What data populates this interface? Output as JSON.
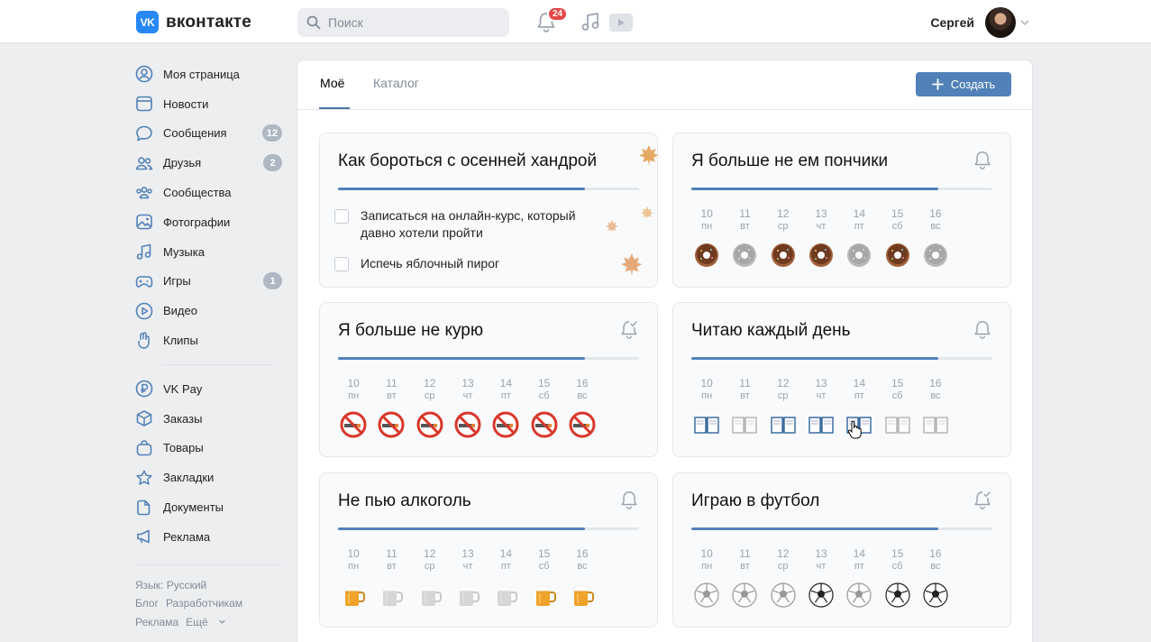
{
  "header": {
    "logo_badge": "VK",
    "logo_text": "вконтакте",
    "search_placeholder": "Поиск",
    "notifications_count": "24",
    "user_name": "Сергей"
  },
  "sidebar": {
    "items": [
      {
        "label": "Моя страница",
        "icon": "user-circle-icon"
      },
      {
        "label": "Новости",
        "icon": "newspaper-icon"
      },
      {
        "label": "Сообщения",
        "icon": "message-icon",
        "count": "12"
      },
      {
        "label": "Друзья",
        "icon": "friends-icon",
        "count": "2"
      },
      {
        "label": "Сообщества",
        "icon": "communities-icon"
      },
      {
        "label": "Фотографии",
        "icon": "photo-icon"
      },
      {
        "label": "Музыка",
        "icon": "music-icon"
      },
      {
        "label": "Игры",
        "icon": "gamepad-icon",
        "count": "1"
      },
      {
        "label": "Видео",
        "icon": "video-icon"
      },
      {
        "label": "Клипы",
        "icon": "clips-icon"
      }
    ],
    "items2": [
      {
        "label": "VK Pay",
        "icon": "vkpay-icon"
      },
      {
        "label": "Заказы",
        "icon": "box-icon"
      },
      {
        "label": "Товары",
        "icon": "bag-icon"
      },
      {
        "label": "Закладки",
        "icon": "star-icon"
      },
      {
        "label": "Документы",
        "icon": "document-icon"
      },
      {
        "label": "Реклама",
        "icon": "megaphone-icon"
      }
    ],
    "footer": {
      "language": "Язык: Русский",
      "blog": "Блог",
      "developers": "Разработчикам",
      "ads": "Реклама",
      "more": "Ещё"
    }
  },
  "tabs": {
    "mine": "Моё",
    "catalog": "Каталог",
    "create": "Создать"
  },
  "days": [
    {
      "num": "10",
      "wd": "пн"
    },
    {
      "num": "11",
      "wd": "вт"
    },
    {
      "num": "12",
      "wd": "ср"
    },
    {
      "num": "13",
      "wd": "чт"
    },
    {
      "num": "14",
      "wd": "пт"
    },
    {
      "num": "15",
      "wd": "сб"
    },
    {
      "num": "16",
      "wd": "вс"
    }
  ],
  "cards": {
    "autumn": {
      "title": "Как бороться с осенней хандрой",
      "progress": 0.82,
      "todo1": "Записаться на онлайн-курс, который давно хотели пройти",
      "todo2": "Испечь яблочный пирог"
    },
    "donuts": {
      "title": "Я больше не ем пончики",
      "progress": 0.82,
      "done": [
        1,
        0,
        1,
        1,
        0,
        1,
        0
      ]
    },
    "smoking": {
      "title": "Я больше не курю",
      "progress": 0.82,
      "done": [
        1,
        1,
        1,
        1,
        1,
        1,
        1
      ]
    },
    "reading": {
      "title": "Читаю каждый день",
      "progress": 0.82,
      "done": [
        1,
        0,
        1,
        1,
        1,
        0,
        0
      ]
    },
    "alcohol": {
      "title": "Не пью алкоголь",
      "progress": 0.82,
      "done": [
        1,
        0,
        0,
        0,
        0,
        1,
        1
      ]
    },
    "football": {
      "title": "Играю в футбол",
      "progress": 0.82,
      "done": [
        0,
        0,
        0,
        1,
        0,
        1,
        1
      ]
    }
  }
}
